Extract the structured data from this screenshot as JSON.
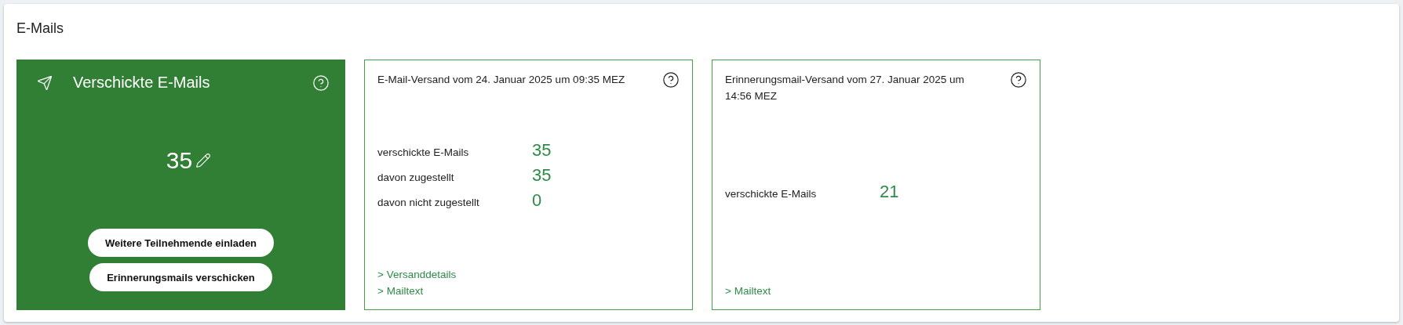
{
  "section": {
    "title": "E-Mails"
  },
  "cards": [
    {
      "kind": "summary",
      "title": "Verschickte E-Mails",
      "count": "35",
      "buttons": [
        "Weitere Teilnehmende einladen",
        "Erinnerungsmails verschicken"
      ]
    },
    {
      "kind": "dispatch",
      "title": "E-Mail-Versand vom 24. Januar 2025 um 09:35 MEZ",
      "stats": [
        {
          "label": "verschickte E-Mails",
          "value": "35"
        },
        {
          "label": "davon zugestellt",
          "value": "35"
        },
        {
          "label": "davon nicht zugestellt",
          "value": "0"
        }
      ],
      "links": [
        "> Versanddetails",
        "> Mailtext"
      ]
    },
    {
      "kind": "dispatch",
      "title": "Erinnerungsmail-Versand vom 27. Januar 2025 um 14:56 MEZ",
      "stats": [
        {
          "label": "verschickte E-Mails",
          "value": "21"
        }
      ],
      "links": [
        "> Mailtext"
      ]
    }
  ]
}
